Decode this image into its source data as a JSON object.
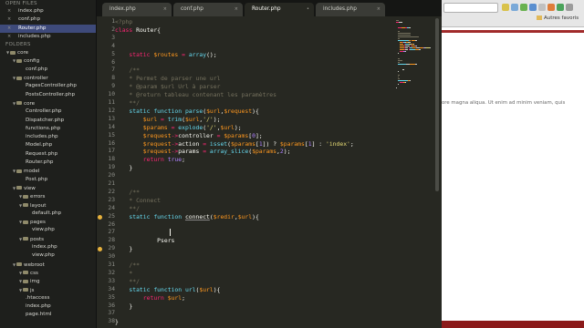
{
  "sidebar": {
    "open_files_label": "OPEN FILES",
    "folders_label": "FOLDERS",
    "open_files": [
      {
        "label": "index.php"
      },
      {
        "label": "conf.php"
      },
      {
        "label": "Router.php"
      },
      {
        "label": "includes.php"
      }
    ],
    "tree": [
      {
        "label": "core",
        "type": "folder",
        "depth": 0
      },
      {
        "label": "config",
        "type": "folder",
        "depth": 1
      },
      {
        "label": "conf.php",
        "type": "file",
        "depth": 2
      },
      {
        "label": "controller",
        "type": "folder",
        "depth": 1
      },
      {
        "label": "PagesController.php",
        "type": "file",
        "depth": 2
      },
      {
        "label": "PostsController.php",
        "type": "file",
        "depth": 2
      },
      {
        "label": "core",
        "type": "folder",
        "depth": 1
      },
      {
        "label": "Controller.php",
        "type": "file",
        "depth": 2
      },
      {
        "label": "Dispatcher.php",
        "type": "file",
        "depth": 2
      },
      {
        "label": "functions.php",
        "type": "file",
        "depth": 2
      },
      {
        "label": "includes.php",
        "type": "file",
        "depth": 2
      },
      {
        "label": "Model.php",
        "type": "file",
        "depth": 2
      },
      {
        "label": "Request.php",
        "type": "file",
        "depth": 2
      },
      {
        "label": "Router.php",
        "type": "file",
        "depth": 2
      },
      {
        "label": "model",
        "type": "folder",
        "depth": 1
      },
      {
        "label": "Post.php",
        "type": "file",
        "depth": 2
      },
      {
        "label": "view",
        "type": "folder",
        "depth": 1
      },
      {
        "label": "errors",
        "type": "folder",
        "depth": 2
      },
      {
        "label": "layout",
        "type": "folder",
        "depth": 2
      },
      {
        "label": "default.php",
        "type": "file",
        "depth": 3
      },
      {
        "label": "pages",
        "type": "folder",
        "depth": 2
      },
      {
        "label": "view.php",
        "type": "file",
        "depth": 3
      },
      {
        "label": "posts",
        "type": "folder",
        "depth": 2
      },
      {
        "label": "index.php",
        "type": "file",
        "depth": 3
      },
      {
        "label": "view.php",
        "type": "file",
        "depth": 3
      },
      {
        "label": "webroot",
        "type": "folder",
        "depth": 1
      },
      {
        "label": "css",
        "type": "folder",
        "depth": 2
      },
      {
        "label": "img",
        "type": "folder",
        "depth": 2
      },
      {
        "label": "js",
        "type": "folder",
        "depth": 2
      },
      {
        "label": ".htaccess",
        "type": "file",
        "depth": 2
      },
      {
        "label": "index.php",
        "type": "file",
        "depth": 2
      },
      {
        "label": "page.html",
        "type": "file",
        "depth": 2
      }
    ]
  },
  "tabs": [
    {
      "label": "index.php",
      "close": "×",
      "active": false
    },
    {
      "label": "conf.php",
      "close": "×",
      "active": false
    },
    {
      "label": "Router.php",
      "close": "•",
      "active": true
    },
    {
      "label": "includes.php",
      "close": "×",
      "active": false
    }
  ],
  "code": {
    "line_numbers": [
      "1",
      "2",
      "3",
      "4",
      "5",
      "6",
      "7",
      "8",
      "9",
      "10",
      "11",
      "12",
      "13",
      "14",
      "15",
      "16",
      "17",
      "18",
      "19",
      "20",
      "21",
      "22",
      "23",
      "24",
      "25",
      "26",
      "27",
      "28",
      "29",
      "30",
      "31",
      "32",
      "33",
      "34",
      "35",
      "36",
      "37",
      "38"
    ],
    "lines": [
      [
        {
          "t": "<?php",
          "c": "c"
        }
      ],
      [
        {
          "t": "class ",
          "c": "k"
        },
        {
          "t": "Router{",
          "c": ""
        }
      ],
      [],
      [],
      [
        {
          "t": "    static ",
          "c": "k"
        },
        {
          "t": "$routes",
          "c": "v"
        },
        {
          "t": " = ",
          "c": "k"
        },
        {
          "t": "array",
          "c": "f"
        },
        {
          "t": "();",
          "c": ""
        }
      ],
      [],
      [
        {
          "t": "    /**",
          "c": "c"
        }
      ],
      [
        {
          "t": "    * Permet de parser une url",
          "c": "c"
        }
      ],
      [
        {
          "t": "    * @param $url Url à parser",
          "c": "c"
        }
      ],
      [
        {
          "t": "    * @return tableau contenant les paramètres",
          "c": "c"
        }
      ],
      [
        {
          "t": "    **/",
          "c": "c"
        }
      ],
      [
        {
          "t": "    static function ",
          "c": "f"
        },
        {
          "t": "parse",
          "c": "f"
        },
        {
          "t": "(",
          "c": ""
        },
        {
          "t": "$url",
          "c": "v"
        },
        {
          "t": ",",
          "c": ""
        },
        {
          "t": "$request",
          "c": "v"
        },
        {
          "t": "){",
          "c": ""
        }
      ],
      [
        {
          "t": "        $url",
          "c": "v"
        },
        {
          "t": " = ",
          "c": "k"
        },
        {
          "t": "trim",
          "c": "f"
        },
        {
          "t": "(",
          "c": ""
        },
        {
          "t": "$url",
          "c": "v"
        },
        {
          "t": ",",
          "c": ""
        },
        {
          "t": "'/'",
          "c": "s"
        },
        {
          "t": ");",
          "c": ""
        }
      ],
      [
        {
          "t": "        $params",
          "c": "v"
        },
        {
          "t": " = ",
          "c": "k"
        },
        {
          "t": "explode",
          "c": "f"
        },
        {
          "t": "(",
          "c": ""
        },
        {
          "t": "'/'",
          "c": "s"
        },
        {
          "t": ",",
          "c": ""
        },
        {
          "t": "$url",
          "c": "v"
        },
        {
          "t": ");",
          "c": ""
        }
      ],
      [
        {
          "t": "        $request",
          "c": "v"
        },
        {
          "t": "->",
          "c": "k"
        },
        {
          "t": "controller",
          "c": ""
        },
        {
          "t": " = ",
          "c": "k"
        },
        {
          "t": "$params",
          "c": "v"
        },
        {
          "t": "[",
          "c": ""
        },
        {
          "t": "0",
          "c": "n"
        },
        {
          "t": "];",
          "c": ""
        }
      ],
      [
        {
          "t": "        $request",
          "c": "v"
        },
        {
          "t": "->",
          "c": "k"
        },
        {
          "t": "action",
          "c": ""
        },
        {
          "t": " = ",
          "c": "k"
        },
        {
          "t": "isset",
          "c": "f"
        },
        {
          "t": "(",
          "c": ""
        },
        {
          "t": "$params",
          "c": "v"
        },
        {
          "t": "[",
          "c": ""
        },
        {
          "t": "1",
          "c": "n"
        },
        {
          "t": "]) ? ",
          "c": ""
        },
        {
          "t": "$params",
          "c": "v"
        },
        {
          "t": "[",
          "c": ""
        },
        {
          "t": "1",
          "c": "n"
        },
        {
          "t": "] : ",
          "c": ""
        },
        {
          "t": "'index'",
          "c": "s"
        },
        {
          "t": ";",
          "c": ""
        }
      ],
      [
        {
          "t": "        $request",
          "c": "v"
        },
        {
          "t": "->",
          "c": "k"
        },
        {
          "t": "params",
          "c": ""
        },
        {
          "t": " = ",
          "c": "k"
        },
        {
          "t": "array_slice",
          "c": "f"
        },
        {
          "t": "(",
          "c": ""
        },
        {
          "t": "$params",
          "c": "v"
        },
        {
          "t": ",",
          "c": ""
        },
        {
          "t": "2",
          "c": "n"
        },
        {
          "t": ");",
          "c": ""
        }
      ],
      [
        {
          "t": "        return ",
          "c": "k"
        },
        {
          "t": "true",
          "c": "n"
        },
        {
          "t": ";",
          "c": ""
        }
      ],
      [
        {
          "t": "    }",
          "c": ""
        }
      ],
      [],
      [],
      [
        {
          "t": "    /**",
          "c": "c"
        }
      ],
      [
        {
          "t": "    * Connect",
          "c": "c"
        }
      ],
      [
        {
          "t": "    **/",
          "c": "c"
        }
      ],
      [
        {
          "t": "    static function ",
          "c": "f"
        },
        {
          "t": "connect",
          "c": "hl"
        },
        {
          "t": "(",
          "c": ""
        },
        {
          "t": "$redir",
          "c": "v"
        },
        {
          "t": ",",
          "c": ""
        },
        {
          "t": "$url",
          "c": "v"
        },
        {
          "t": "){",
          "c": ""
        }
      ],
      [],
      [],
      [
        {
          "t": "            Psers",
          "c": ""
        }
      ],
      [
        {
          "t": "    }",
          "c": ""
        }
      ],
      [],
      [
        {
          "t": "    /**",
          "c": "c"
        }
      ],
      [
        {
          "t": "    *",
          "c": "c"
        }
      ],
      [
        {
          "t": "    **/",
          "c": "c"
        }
      ],
      [
        {
          "t": "    static function ",
          "c": "f"
        },
        {
          "t": "url",
          "c": "f"
        },
        {
          "t": "(",
          "c": ""
        },
        {
          "t": "$url",
          "c": "v"
        },
        {
          "t": "){",
          "c": ""
        }
      ],
      [
        {
          "t": "        return ",
          "c": "k"
        },
        {
          "t": "$url",
          "c": "v"
        },
        {
          "t": ";",
          "c": ""
        }
      ],
      [
        {
          "t": "    }",
          "c": ""
        }
      ],
      [],
      [
        {
          "t": "}",
          "c": ""
        }
      ]
    ],
    "modified_line_markers": [
      25,
      29
    ]
  },
  "browser": {
    "bookmark_folder": "Autres favoris",
    "body_text": "ore magna aliqua. Ut enim ad minim veniam, quis",
    "accent": "#8b1a1a"
  },
  "colors": {
    "editor_bg": "#272822",
    "sidebar_bg": "#1e1f1c",
    "active_file_bg": "#3e4a7a",
    "keyword": "#f92672",
    "function": "#66d9ef",
    "string": "#e6db74",
    "variable": "#fd971f",
    "comment": "#75715e",
    "number": "#ae81ff"
  }
}
